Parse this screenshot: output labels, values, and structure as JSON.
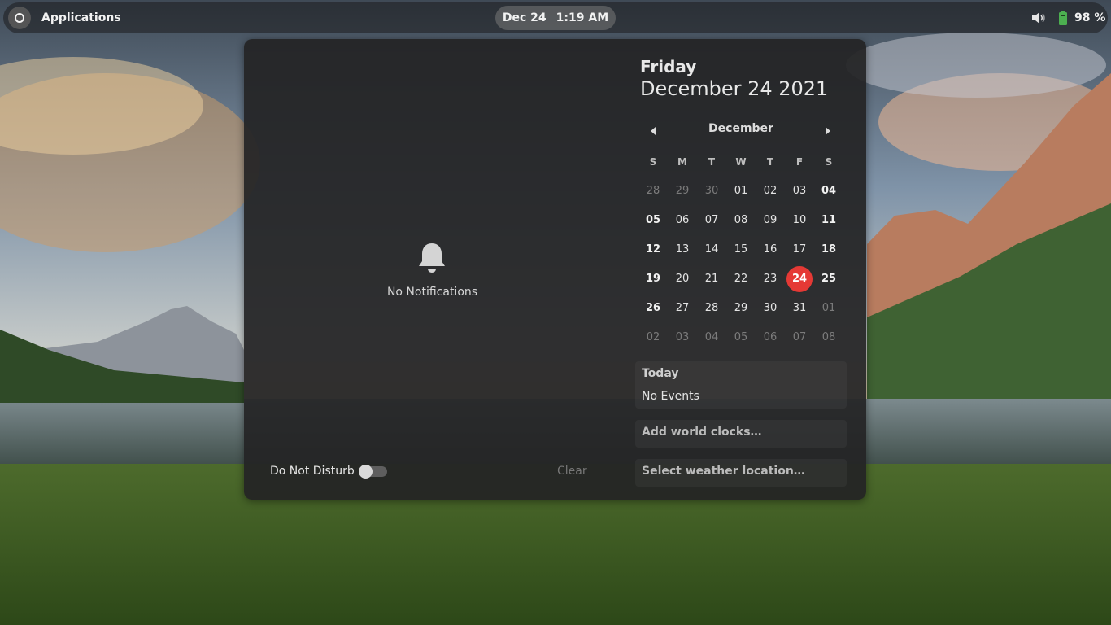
{
  "topbar": {
    "activities_icon": "activities-ring-icon",
    "apps_label": "Applications",
    "clock_date": "Dec 24",
    "clock_time": "1:19 AM",
    "volume_icon": "volume-icon",
    "battery_icon": "battery-icon",
    "battery_text": "98 %",
    "battery_color": "#4caf50"
  },
  "notifications": {
    "bell_icon": "bell-icon",
    "empty_label": "No Notifications",
    "dnd_label": "Do Not Disturb",
    "dnd_enabled": false,
    "clear_label": "Clear"
  },
  "calendar": {
    "weekday": "Friday",
    "full_date": "December 24 2021",
    "month": "December",
    "prev_icon": "chevron-left-icon",
    "next_icon": "chevron-right-icon",
    "day_headers": [
      "S",
      "M",
      "T",
      "W",
      "T",
      "F",
      "S"
    ],
    "weeks": [
      [
        {
          "d": "28",
          "m": false
        },
        {
          "d": "29",
          "m": false
        },
        {
          "d": "30",
          "m": false
        },
        {
          "d": "01",
          "m": true
        },
        {
          "d": "02",
          "m": true
        },
        {
          "d": "03",
          "m": true
        },
        {
          "d": "04",
          "m": true
        }
      ],
      [
        {
          "d": "05",
          "m": true
        },
        {
          "d": "06",
          "m": true
        },
        {
          "d": "07",
          "m": true
        },
        {
          "d": "08",
          "m": true
        },
        {
          "d": "09",
          "m": true
        },
        {
          "d": "10",
          "m": true
        },
        {
          "d": "11",
          "m": true
        }
      ],
      [
        {
          "d": "12",
          "m": true
        },
        {
          "d": "13",
          "m": true
        },
        {
          "d": "14",
          "m": true
        },
        {
          "d": "15",
          "m": true
        },
        {
          "d": "16",
          "m": true
        },
        {
          "d": "17",
          "m": true
        },
        {
          "d": "18",
          "m": true
        }
      ],
      [
        {
          "d": "19",
          "m": true
        },
        {
          "d": "20",
          "m": true
        },
        {
          "d": "21",
          "m": true
        },
        {
          "d": "22",
          "m": true
        },
        {
          "d": "23",
          "m": true
        },
        {
          "d": "24",
          "m": true,
          "today": true
        },
        {
          "d": "25",
          "m": true
        }
      ],
      [
        {
          "d": "26",
          "m": true
        },
        {
          "d": "27",
          "m": true
        },
        {
          "d": "28",
          "m": true
        },
        {
          "d": "29",
          "m": true
        },
        {
          "d": "30",
          "m": true
        },
        {
          "d": "31",
          "m": true
        },
        {
          "d": "01",
          "m": false
        }
      ],
      [
        {
          "d": "02",
          "m": false
        },
        {
          "d": "03",
          "m": false
        },
        {
          "d": "04",
          "m": false
        },
        {
          "d": "05",
          "m": false
        },
        {
          "d": "06",
          "m": false
        },
        {
          "d": "07",
          "m": false
        },
        {
          "d": "08",
          "m": false
        }
      ]
    ],
    "today_color": "#e53935",
    "events_title": "Today",
    "events_empty": "No Events",
    "world_clocks_label": "Add world clocks…",
    "weather_label": "Select weather location…"
  }
}
